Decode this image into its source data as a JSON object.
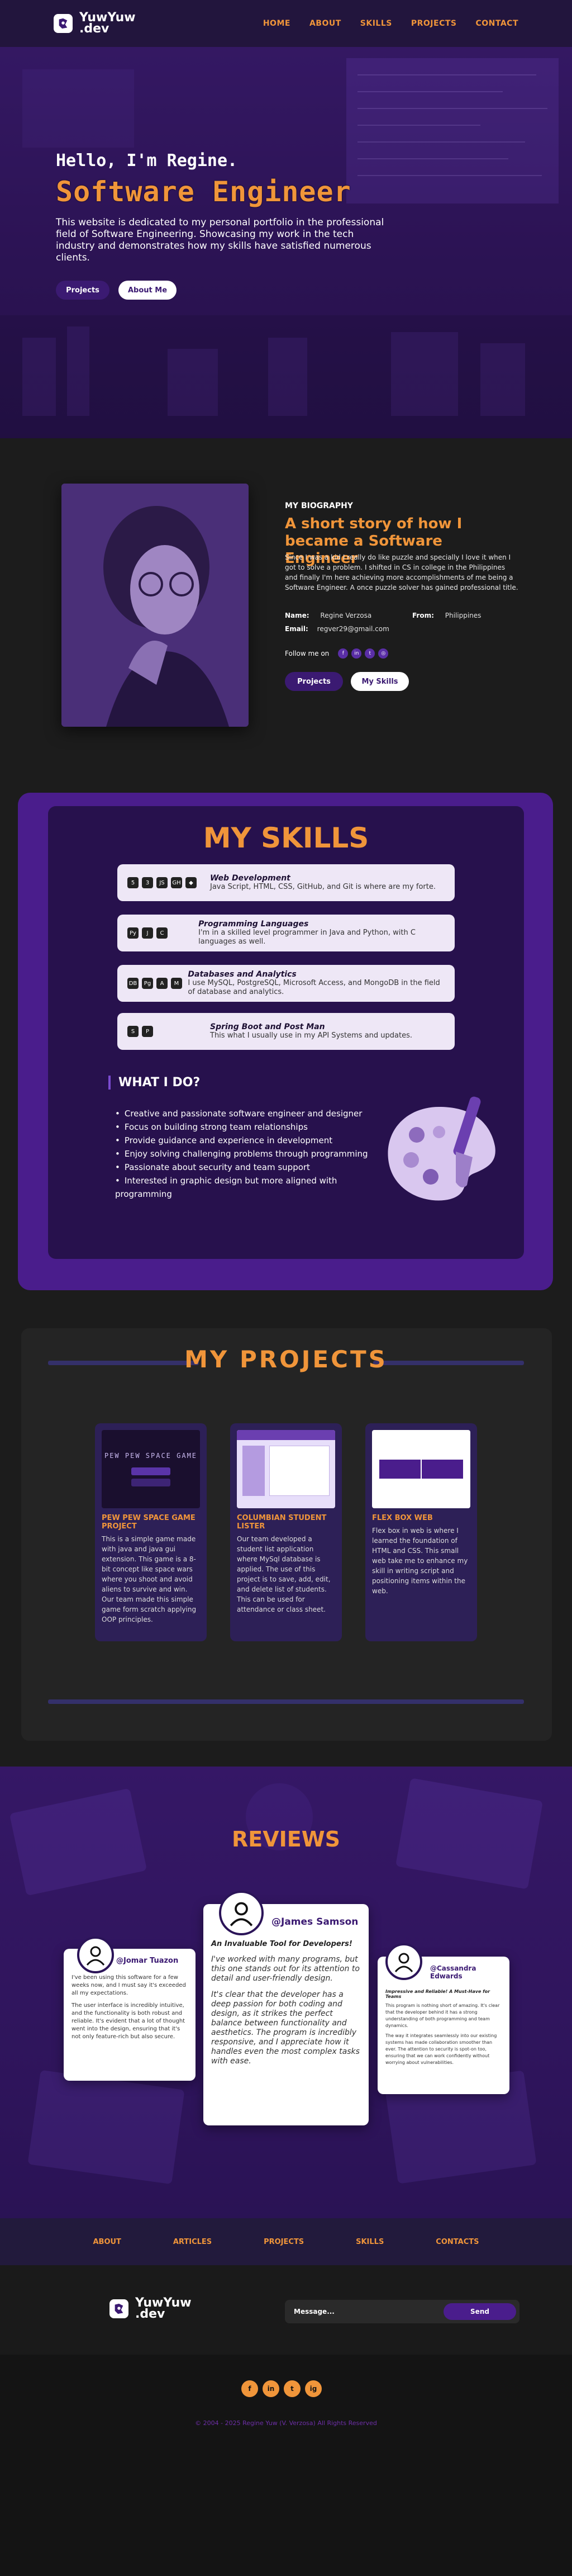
{
  "nav": {
    "logo_line1": "YuwYuw",
    "logo_line2": ".dev",
    "links": [
      "HOME",
      "ABOUT",
      "SKILLS",
      "PROJECTS",
      "CONTACT"
    ]
  },
  "hero": {
    "hello": "Hello, I'm Regine.",
    "role": "Software Engineer",
    "description": "This website is dedicated to my personal portfolio in the professional field of Software Engineering. Showcasing my work in the tech industry and demonstrates how my skills have satisfied numerous clients.",
    "btn_projects": "Projects",
    "btn_about": "About Me"
  },
  "bio": {
    "kicker": "MY BIOGRAPHY",
    "title": "A short story of how I became a Software Engineer",
    "text": "Since I was a kid I really do like puzzle and specially I love it when I got to solve a problem. I shifted in CS in college in the Philippines and finally I'm here achieving more accomplishments of me being a Software Engineer. A once puzzle solver has gained professional title.",
    "name_label": "Name:",
    "name_value": "Regine Verzosa",
    "from_label": "From:",
    "from_value": "Philippines",
    "email_label": "Email:",
    "email_value": "regver29@gmail.com",
    "follow_label": "Follow me on",
    "btn_projects": "Projects",
    "btn_skills": "My Skills"
  },
  "skills": {
    "title": "MY SKILLS",
    "cards": [
      {
        "title": "Web Development",
        "desc": "Java Script, HTML, CSS, GitHub, and Git is where are my forte.",
        "icons": [
          "5",
          "3",
          "JS",
          "GH",
          "◆"
        ]
      },
      {
        "title": "Programming Languages",
        "desc": "I'm in a skilled level programmer in Java and Python, with C languages as well.",
        "icons": [
          "Py",
          "J",
          "C"
        ]
      },
      {
        "title": "Databases and Analytics",
        "desc": "I use MySQL, PostgreSQL, Microsoft Access, and MongoDB in the field of database and analytics.",
        "icons": [
          "DB",
          "Pg",
          "A",
          "M"
        ]
      },
      {
        "title": "Spring Boot and Post Man",
        "desc": "This what I usually use in my API Systems and updates.",
        "icons": [
          "S",
          "P"
        ]
      }
    ],
    "what_title": "WHAT I DO?",
    "what_list": [
      "Creative and passionate software engineer and designer",
      "Focus on building strong team relationships",
      "Provide guidance and experience in development",
      "Enjoy solving challenging problems through programming",
      "Passionate about security and team support",
      "Interested in graphic design but more aligned with programming"
    ]
  },
  "projects": {
    "title": "MY PROJECTS",
    "items": [
      {
        "name": "PEW PEW SPACE GAME PROJECT",
        "desc": "This is a simple game made with java and java gui extension. This game is a 8-bit concept like space wars where you shoot and avoid aliens to survive and win. Our team made this simple game form scratch applying OOP principles.",
        "thumb_title": "PEW PEW SPACE GAME"
      },
      {
        "name": "COLUMBIAN STUDENT LISTER",
        "desc": "Our team developed a student list application where MySql database is applied. The use of this project is to save, add, edit, and delete list of students. This can be used for attendance or class sheet."
      },
      {
        "name": "FLEX BOX WEB",
        "desc": "Flex box in web is where I learned the foundation of HTML and CSS. This small web take me to enhance my skill in writing script and positioning items within the web."
      }
    ]
  },
  "reviews": {
    "title": "REVIEWS",
    "items": [
      {
        "name": "@Jomar Tuazon",
        "head": "",
        "body1": "I've been using this software for a few weeks now, and I must say it's exceeded all my expectations.",
        "body2": "The user interface is incredibly intuitive, and the functionality is both robust and reliable. It's evident that a lot of thought went into the design, ensuring that it's not only feature-rich but also secure."
      },
      {
        "name": "@James Samson",
        "head": "An Invaluable Tool for Developers!",
        "body1": "I've worked with many programs, but this one stands out for its attention to detail and user-friendly design.",
        "body2": "It's clear that the developer has a deep passion for both coding and design, as it strikes the perfect balance between functionality and aesthetics. The program is incredibly responsive, and I appreciate how it handles even the most complex tasks with ease."
      },
      {
        "name": "@Cassandra Edwards",
        "head": "Impressive and Reliable! A Must-Have for Teams",
        "body1": "This program is nothing short of amazing. It's clear that the developer behind it has a strong understanding of both programming and team dynamics.",
        "body2": "The way it integrates seamlessly into our existing systems has made collaboration smoother than ever. The attention to security is spot-on too, ensuring that we can work confidently without worrying about vulnerabilities."
      }
    ]
  },
  "footer": {
    "links": [
      "ABOUT",
      "ARTICLES",
      "PROJECTS",
      "SKILLS",
      "CONTACTS"
    ],
    "logo_line1": "YuwYuw",
    "logo_line2": ".dev",
    "message_placeholder": "Message...",
    "send": "Send",
    "social": [
      "f",
      "in",
      "t",
      "ig"
    ],
    "copyright": "© 2004 - 2025 Regine Yuw (V. Verzosa) All Rights Reserved"
  },
  "colors": {
    "accent": "#f0953a",
    "purple_dark": "#22153d",
    "purple": "#4a1d8c"
  }
}
